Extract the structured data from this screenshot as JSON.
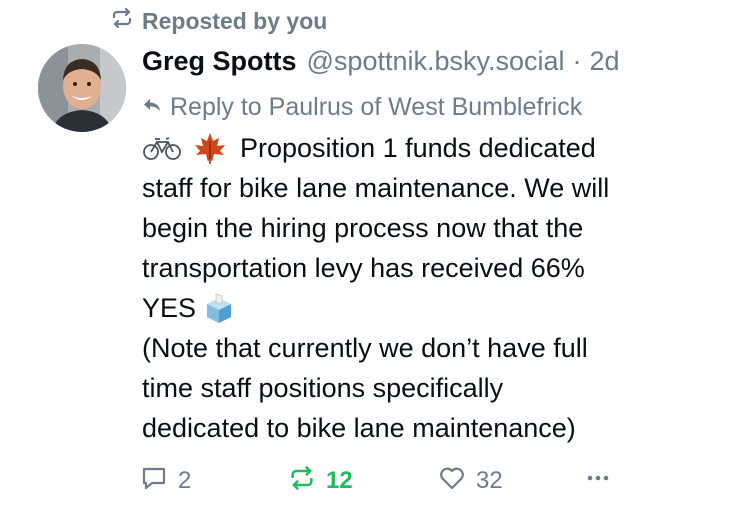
{
  "repost_banner": {
    "text": "Reposted by you",
    "icon": "repost-icon"
  },
  "author": {
    "name": "Greg Spotts",
    "handle": "@spottnik.bsky.social",
    "separator": "·",
    "time": "2d",
    "avatar_icon": "avatar"
  },
  "reply_context": {
    "text": "Reply to Paulrus of West Bumblefrick",
    "icon": "reply-arrow-icon"
  },
  "post": {
    "line1": "Proposition 1 funds dedicated",
    "line2": "staff for bike lane maintenance. We will",
    "line3": "begin the hiring process now that the",
    "line4": "transportation levy has received 66%",
    "line5": "YES",
    "line6": "(Note that currently we don’t have full",
    "line7": "time staff positions specifically",
    "line8": "dedicated to bike lane maintenance)",
    "emojis": [
      "bicycle-emoji",
      "maple-leaf-emoji",
      "ballot-box-emoji"
    ]
  },
  "actions": {
    "reply_count": "2",
    "repost_count": "12",
    "like_count": "32",
    "more_icon": "more-icon"
  },
  "colors": {
    "muted": "#6f7b88",
    "text": "#0b0f14",
    "repost_active": "#20bc5d",
    "background": "#ffffff"
  }
}
